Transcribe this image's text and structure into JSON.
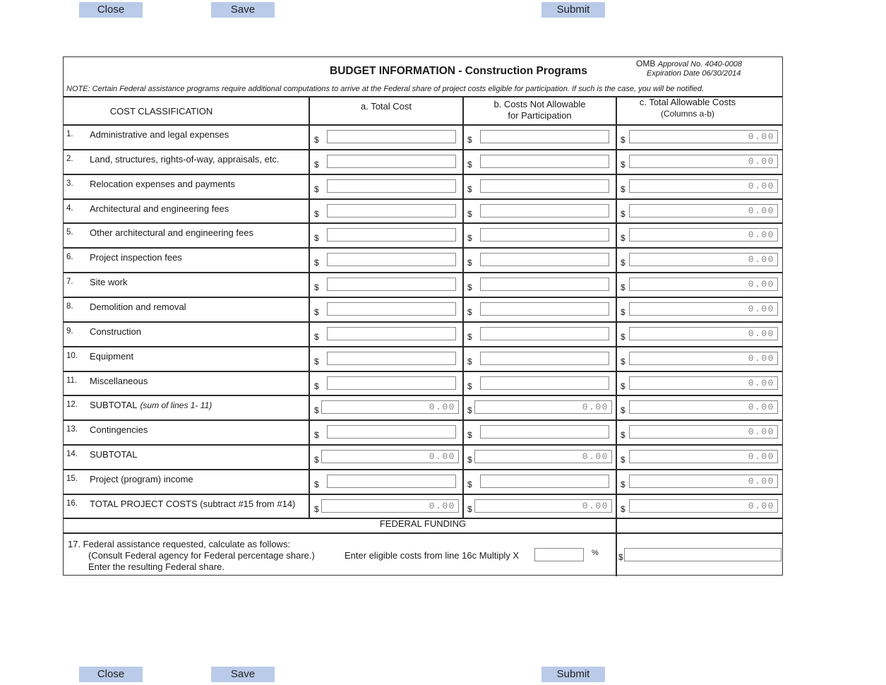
{
  "toolbar": {
    "close_label": "Close",
    "save_label": "Save",
    "submit_label": "Submit"
  },
  "form": {
    "title": "BUDGET INFORMATION - Construction Programs",
    "omb_prefix": "OMB",
    "omb_approval": "Approval No. 4040-0008",
    "expiration": "Expiration Date 06/30/2014",
    "note": "NOTE: Certain Federal assistance programs require additional computations to arrive at the Federal share of project costs eligible for participation. If such is the case, you will be notified.",
    "columns": {
      "classification": "COST CLASSIFICATION",
      "a": "a. Total Cost",
      "b_line1": "b. Costs Not Allowable",
      "b_line2": "for Participation",
      "c_line1": "c. Total Allowable Costs",
      "c_line2": "(Columns a-b)"
    },
    "currency_symbol": "$",
    "rows": [
      {
        "num": "1.",
        "label": "Administrative and legal expenses",
        "a": "",
        "b": "",
        "c": "0.00"
      },
      {
        "num": "2.",
        "label": "Land, structures, rights-of-way, appraisals, etc.",
        "a": "",
        "b": "",
        "c": "0.00"
      },
      {
        "num": "3.",
        "label": "Relocation expenses and payments",
        "a": "",
        "b": "",
        "c": "0.00"
      },
      {
        "num": "4.",
        "label": "Architectural and engineering fees",
        "a": "",
        "b": "",
        "c": "0.00"
      },
      {
        "num": "5.",
        "label": "Other architectural and engineering fees",
        "a": "",
        "b": "",
        "c": "0.00"
      },
      {
        "num": "6.",
        "label": "Project inspection fees",
        "a": "",
        "b": "",
        "c": "0.00"
      },
      {
        "num": "7.",
        "label": "Site work",
        "a": "",
        "b": "",
        "c": "0.00"
      },
      {
        "num": "8.",
        "label": "Demolition and removal",
        "a": "",
        "b": "",
        "c": "0.00"
      },
      {
        "num": "9.",
        "label": "Construction",
        "a": "",
        "b": "",
        "c": "0.00"
      },
      {
        "num": "10.",
        "label": "Equipment",
        "a": "",
        "b": "",
        "c": "0.00"
      },
      {
        "num": "11.",
        "label": "Miscellaneous",
        "a": "",
        "b": "",
        "c": "0.00"
      },
      {
        "num": "12.",
        "label": "SUBTOTAL",
        "label_note": "(sum of lines 1- 11)",
        "a": "0.00",
        "b": "0.00",
        "c": "0.00"
      },
      {
        "num": "13.",
        "label": "Contingencies",
        "a": "",
        "b": "",
        "c": "0.00"
      },
      {
        "num": "14.",
        "label": "SUBTOTAL",
        "a": "0.00",
        "b": "0.00",
        "c": "0.00"
      },
      {
        "num": "15.",
        "label": "Project (program) income",
        "a": "",
        "b": "",
        "c": "0.00"
      },
      {
        "num": "16.",
        "label": "TOTAL PROJECT COSTS (subtract #15 from #14)",
        "a": "0.00",
        "b": "0.00",
        "c": "0.00"
      }
    ],
    "federal_funding": {
      "heading": "FEDERAL FUNDING",
      "line17_1": "17. Federal assistance requested, calculate as follows:",
      "line17_2": "(Consult Federal agency for Federal percentage share.)",
      "line17_3": "Enter the resulting Federal share.",
      "multiply_label": "Enter eligible costs from line 16c Multiply X",
      "percent_value": "",
      "percent_sign": "%",
      "federal_share_value": ""
    }
  }
}
